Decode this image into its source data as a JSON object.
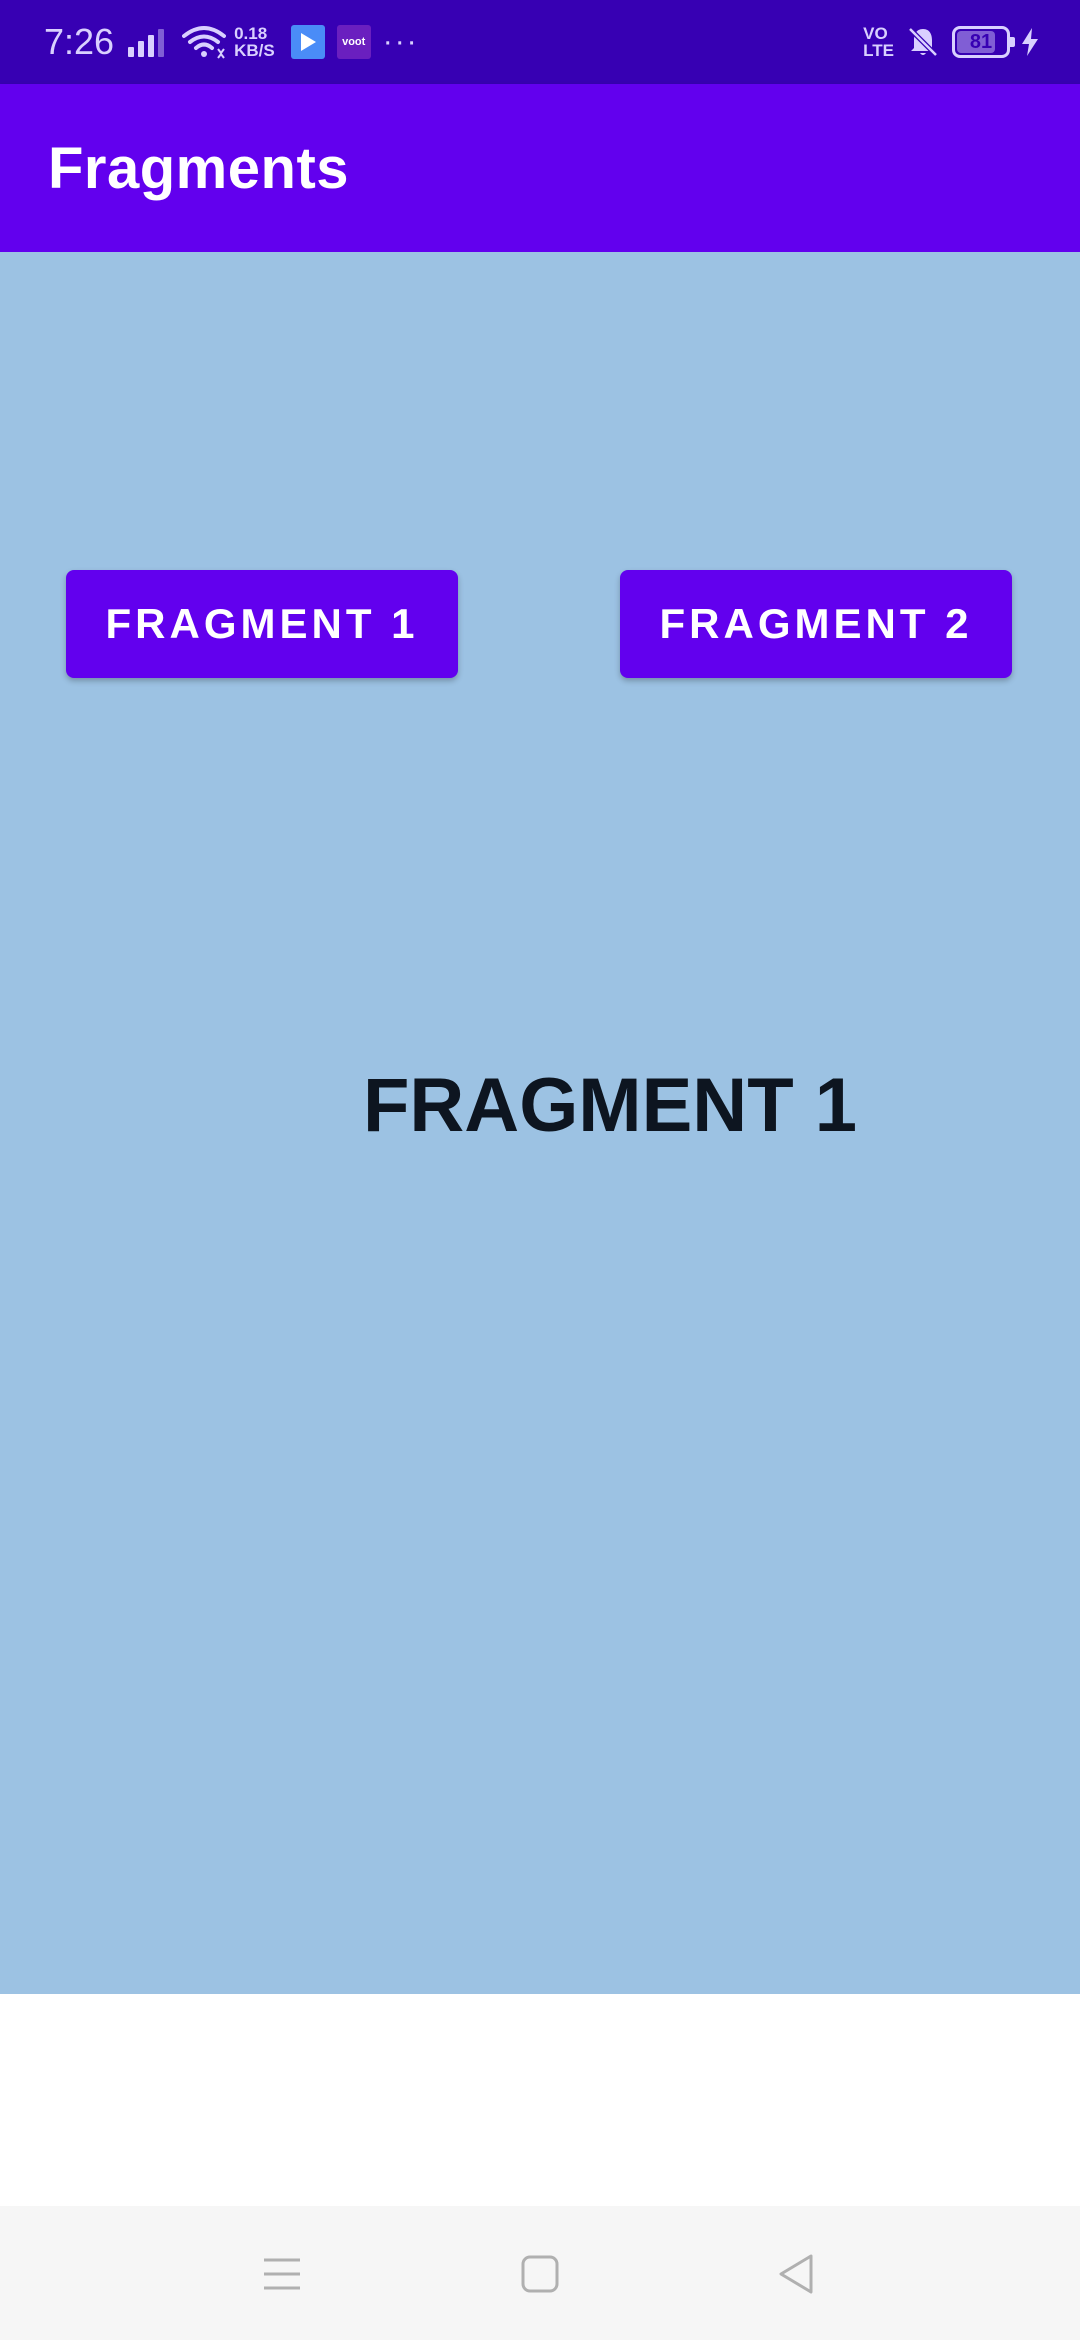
{
  "status_bar": {
    "time": "7:26",
    "net_speed_value": "0.18",
    "net_speed_unit": "KB/S",
    "voot_label": "voot",
    "more": "···",
    "volte_top": "VO",
    "volte_bottom": "LTE",
    "battery": "81",
    "battery_fraction": 0.81
  },
  "app_bar": {
    "title": "Fragments"
  },
  "content": {
    "button1_label": "FRAGMENT 1",
    "button2_label": "FRAGMENT 2",
    "fragment_text": "FRAGMENT 1"
  },
  "colors": {
    "status_bar": "#3700b3",
    "primary": "#6200ee",
    "content_bg": "#9cc2e3",
    "nav_bg": "#f6f6f6"
  },
  "icons": {
    "signal": "signal-icon",
    "wifi": "wifi-icon",
    "play_app": "play-store-icon",
    "voot_app": "voot-app-icon",
    "bell_muted": "bell-off-icon",
    "battery": "battery-icon",
    "charging": "charging-bolt-icon",
    "nav_menu": "menu-icon",
    "nav_home": "home-square-icon",
    "nav_back": "back-triangle-icon"
  }
}
